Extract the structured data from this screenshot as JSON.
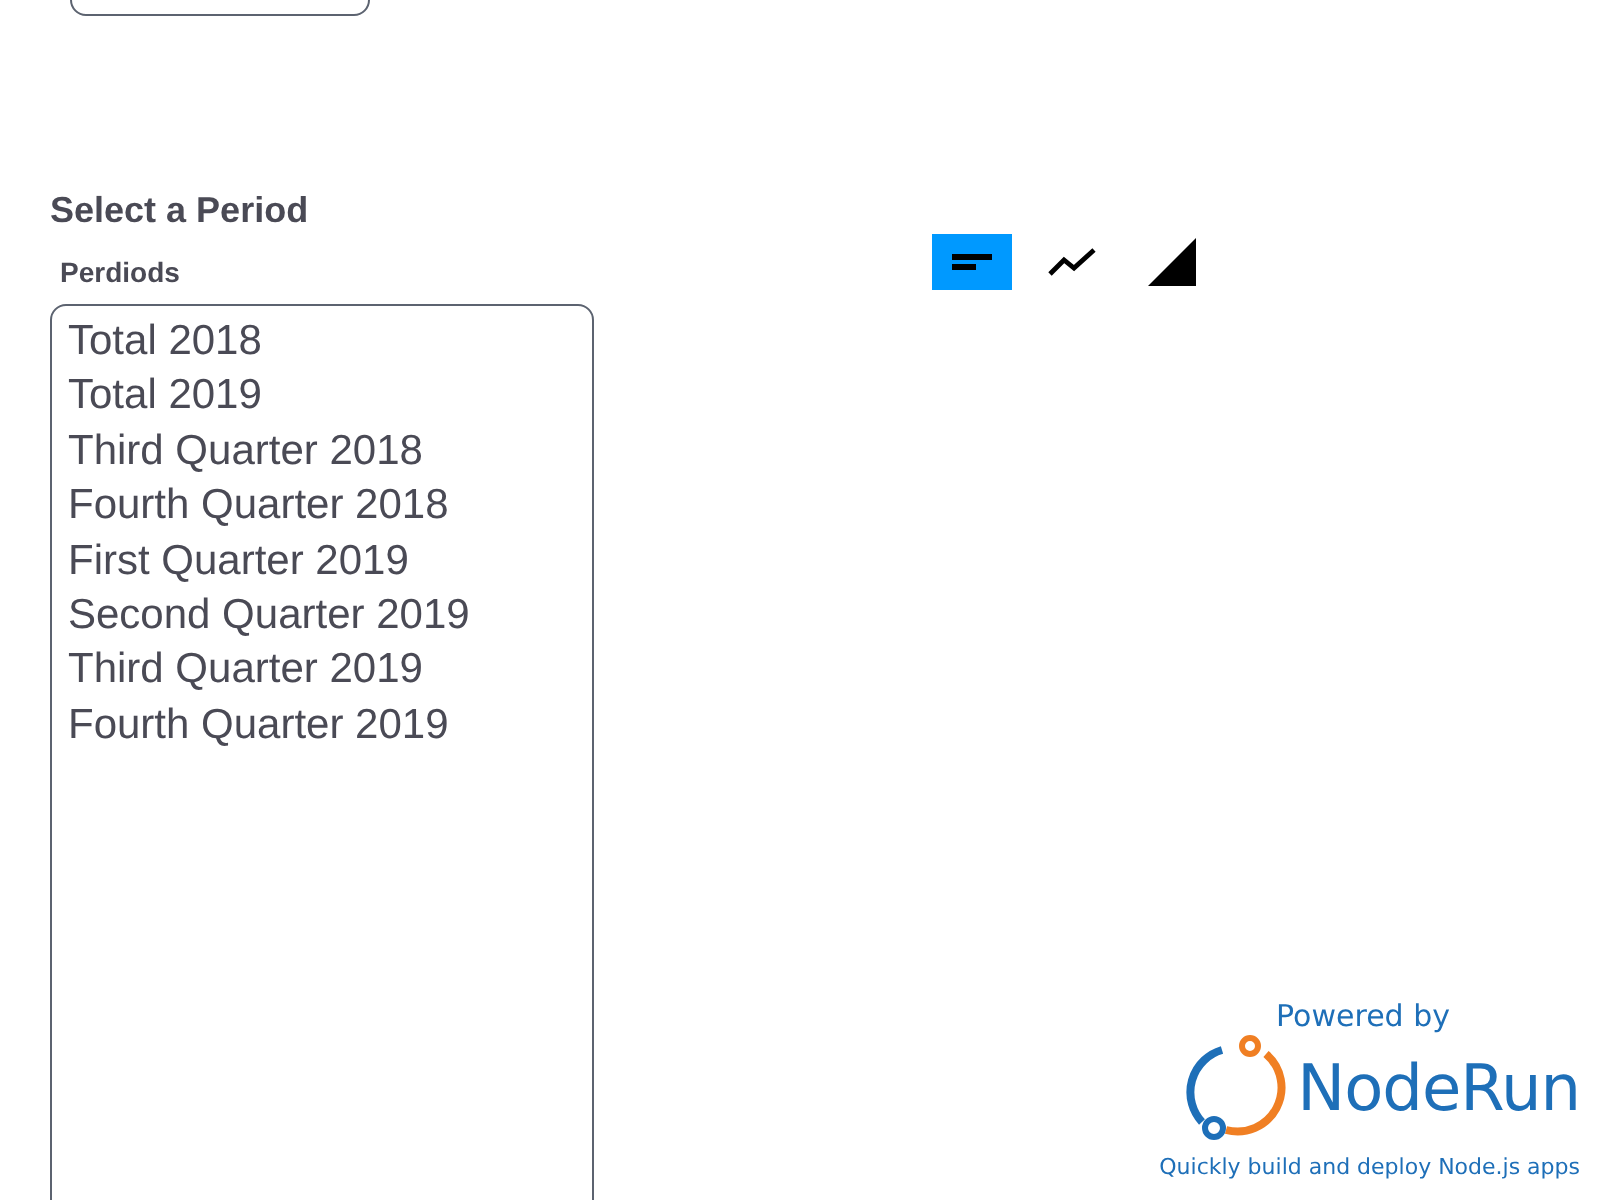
{
  "heading": "Select a Period",
  "periods": {
    "label": "Perdiods",
    "options": [
      {
        "label": "Total 2018",
        "selected": false
      },
      {
        "label": "Total 2019",
        "selected": false
      },
      {
        "label": "Third Quarter 2018",
        "selected": false
      },
      {
        "label": "Fourth Quarter 2018",
        "selected": false
      },
      {
        "label": "First Quarter 2019",
        "selected": false
      },
      {
        "label": "Second Quarter 2019",
        "selected": false
      },
      {
        "label": "Third Quarter 2019",
        "selected": false
      },
      {
        "label": "Fourth Quarter 2019",
        "selected": false
      }
    ]
  },
  "chart_types": [
    {
      "kind": "bar",
      "selected": true
    },
    {
      "kind": "line",
      "selected": false
    },
    {
      "kind": "area",
      "selected": false
    }
  ],
  "badge": {
    "powered_by": "Powered by",
    "brand": "NodeRun",
    "tagline": "Quickly build and deploy Node.js apps"
  }
}
